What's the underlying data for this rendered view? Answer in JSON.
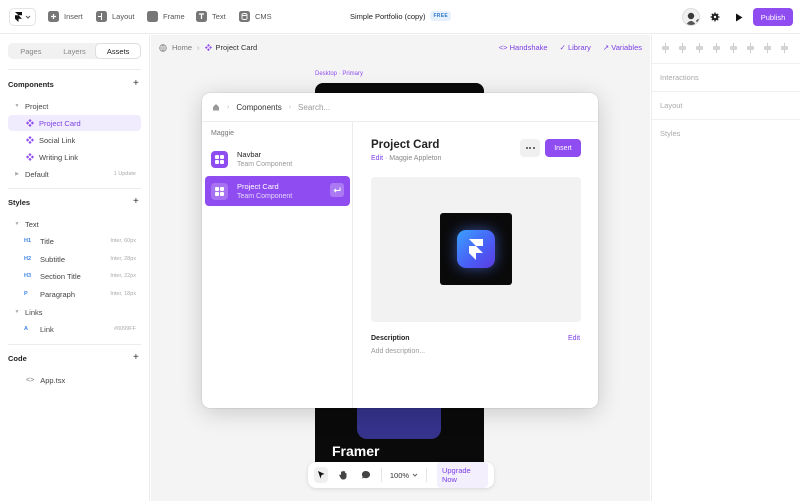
{
  "topbar": {
    "tools": [
      {
        "label": "Insert",
        "icon": "plus-icon"
      },
      {
        "label": "Layout",
        "icon": "layout-icon"
      },
      {
        "label": "Frame",
        "icon": "frame-icon"
      },
      {
        "label": "Text",
        "icon": "text-icon"
      },
      {
        "label": "CMS",
        "icon": "database-icon"
      }
    ],
    "project_title": "Simple Portfolio (copy)",
    "plan_badge": "FREE",
    "publish_label": "Publish"
  },
  "sidebar": {
    "tabs": [
      "Pages",
      "Layers",
      "Assets"
    ],
    "active_tab": "Assets",
    "components": {
      "heading": "Components",
      "project_group": "Project",
      "items": [
        "Project Card",
        "Social Link",
        "Writing Link"
      ],
      "selected": "Project Card",
      "default_group": "Default",
      "default_meta": "1 Update"
    },
    "styles": {
      "heading": "Styles",
      "text_group": "Text",
      "text_items": [
        {
          "tag": "H1",
          "name": "Title",
          "meta": "Inter, 60px"
        },
        {
          "tag": "H2",
          "name": "Subtitle",
          "meta": "Inter, 28px"
        },
        {
          "tag": "H3",
          "name": "Section Title",
          "meta": "Inter, 22px"
        },
        {
          "tag": "P",
          "name": "Paragraph",
          "meta": "Inter, 18px"
        }
      ],
      "links_group": "Links",
      "link_items": [
        {
          "tag": "A",
          "name": "Link",
          "meta": "#0099FF"
        }
      ]
    },
    "code": {
      "heading": "Code",
      "items": [
        "App.tsx"
      ]
    }
  },
  "canvas": {
    "breadcrumb": {
      "home": "Home",
      "current": "Project Card"
    },
    "links": [
      "Handshake",
      "Library",
      "Variables"
    ],
    "frame_label": "Desktop · Primary",
    "frame_text": "Framer",
    "zoom": "100%",
    "upgrade_label": "Upgrade Now"
  },
  "right_panel": {
    "sections": [
      "Interactions",
      "Layout",
      "Styles"
    ]
  },
  "modal": {
    "breadcrumb": "Components",
    "search_placeholder": "Search...",
    "group": "Maggie",
    "items": [
      {
        "name": "Navbar",
        "sub": "Team Component"
      },
      {
        "name": "Project Card",
        "sub": "Team Component"
      }
    ],
    "selected": "Project Card",
    "detail": {
      "title": "Project Card",
      "edit_label": "Edit",
      "author": "· Maggie Appleton",
      "insert_label": "Insert",
      "description_label": "Description",
      "description_edit": "Edit",
      "description_placeholder": "Add description..."
    }
  },
  "colors": {
    "accent": "#8f4cf0",
    "selected_bg": "#f1ecfd"
  }
}
